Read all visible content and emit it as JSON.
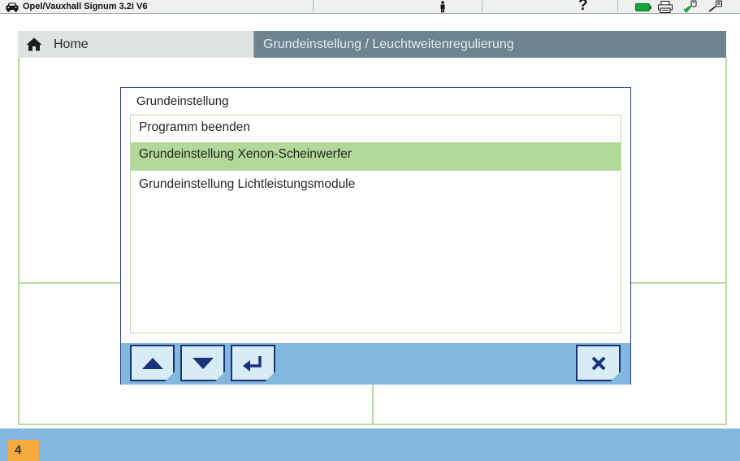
{
  "topbar": {
    "vehicle_title": "Opel/Vauxhall Signum 3.2i V6",
    "help_label": "?",
    "icons": [
      "car-icon",
      "person-icon",
      "help-icon",
      "battery-icon",
      "printer-icon",
      "connector-ok-icon",
      "connector-icon"
    ],
    "colors": {
      "battery": "#17a63a",
      "connector_ok": "#17a63a"
    }
  },
  "nav": {
    "home_label": "Home",
    "path_label": "Grundeinstellung / Leuchtweitenregulierung"
  },
  "dialog": {
    "title": "Grundeinstellung",
    "items": [
      {
        "label": "Programm beenden",
        "selected": false
      },
      {
        "label": "Grundeinstellung Xenon-Scheinwerfer",
        "selected": true
      },
      {
        "label": "Grundeinstellung Lichtleistungsmodule",
        "selected": false
      }
    ],
    "buttons": [
      "up-arrow-icon",
      "down-arrow-icon",
      "enter-icon",
      "close-icon"
    ]
  },
  "footer": {
    "page_number": "4"
  },
  "colors": {
    "accent_blue": "#84b7de",
    "selection_green": "#b2d89a",
    "frame_green": "#b8dba0",
    "nav_dark": "#6c848e",
    "badge_orange": "#f4ab3c",
    "button_border": "#18337a"
  }
}
